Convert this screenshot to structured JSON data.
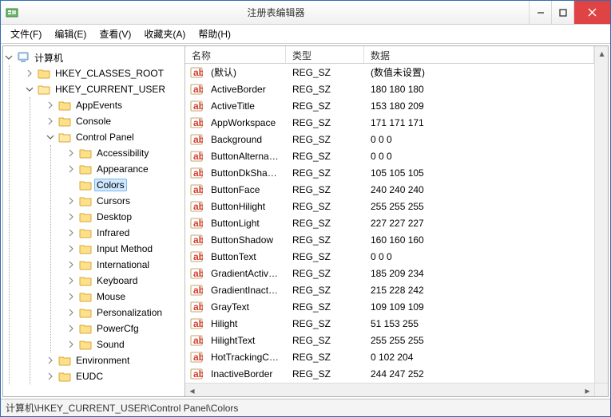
{
  "window": {
    "title": "注册表编辑器"
  },
  "menubar": [
    "文件(F)",
    "编辑(E)",
    "查看(V)",
    "收藏夹(A)",
    "帮助(H)"
  ],
  "tree": {
    "root": {
      "label": "计算机",
      "expanded": true
    },
    "hives": [
      {
        "label": "HKEY_CLASSES_ROOT",
        "expanded": false,
        "children": null
      },
      {
        "label": "HKEY_CURRENT_USER",
        "expanded": true,
        "children": [
          {
            "label": "AppEvents"
          },
          {
            "label": "Console"
          },
          {
            "label": "Control Panel",
            "expanded": true,
            "children": [
              {
                "label": "Accessibility"
              },
              {
                "label": "Appearance"
              },
              {
                "label": "Colors",
                "selected": true,
                "leaf": true
              },
              {
                "label": "Cursors"
              },
              {
                "label": "Desktop"
              },
              {
                "label": "Infrared"
              },
              {
                "label": "Input Method"
              },
              {
                "label": "International"
              },
              {
                "label": "Keyboard"
              },
              {
                "label": "Mouse"
              },
              {
                "label": "Personalization"
              },
              {
                "label": "PowerCfg"
              },
              {
                "label": "Sound"
              }
            ]
          },
          {
            "label": "Environment"
          },
          {
            "label": "EUDC"
          }
        ]
      }
    ]
  },
  "columns": {
    "name": "名称",
    "type": "类型",
    "data": "数据"
  },
  "values": [
    {
      "name": "(默认)",
      "type": "REG_SZ",
      "data": "(数值未设置)"
    },
    {
      "name": "ActiveBorder",
      "type": "REG_SZ",
      "data": "180 180 180"
    },
    {
      "name": "ActiveTitle",
      "type": "REG_SZ",
      "data": "153 180 209"
    },
    {
      "name": "AppWorkspace",
      "type": "REG_SZ",
      "data": "171 171 171"
    },
    {
      "name": "Background",
      "type": "REG_SZ",
      "data": "0 0 0"
    },
    {
      "name": "ButtonAlternat...",
      "type": "REG_SZ",
      "data": "0 0 0"
    },
    {
      "name": "ButtonDkShad...",
      "type": "REG_SZ",
      "data": "105 105 105"
    },
    {
      "name": "ButtonFace",
      "type": "REG_SZ",
      "data": "240 240 240"
    },
    {
      "name": "ButtonHilight",
      "type": "REG_SZ",
      "data": "255 255 255"
    },
    {
      "name": "ButtonLight",
      "type": "REG_SZ",
      "data": "227 227 227"
    },
    {
      "name": "ButtonShadow",
      "type": "REG_SZ",
      "data": "160 160 160"
    },
    {
      "name": "ButtonText",
      "type": "REG_SZ",
      "data": "0 0 0"
    },
    {
      "name": "GradientActive...",
      "type": "REG_SZ",
      "data": "185 209 234"
    },
    {
      "name": "GradientInactiv...",
      "type": "REG_SZ",
      "data": "215 228 242"
    },
    {
      "name": "GrayText",
      "type": "REG_SZ",
      "data": "109 109 109"
    },
    {
      "name": "Hilight",
      "type": "REG_SZ",
      "data": "51 153 255"
    },
    {
      "name": "HilightText",
      "type": "REG_SZ",
      "data": "255 255 255"
    },
    {
      "name": "HotTrackingCo...",
      "type": "REG_SZ",
      "data": "0 102 204"
    },
    {
      "name": "InactiveBorder",
      "type": "REG_SZ",
      "data": "244 247 252"
    }
  ],
  "statusbar": {
    "path": "计算机\\HKEY_CURRENT_USER\\Control Panel\\Colors"
  }
}
